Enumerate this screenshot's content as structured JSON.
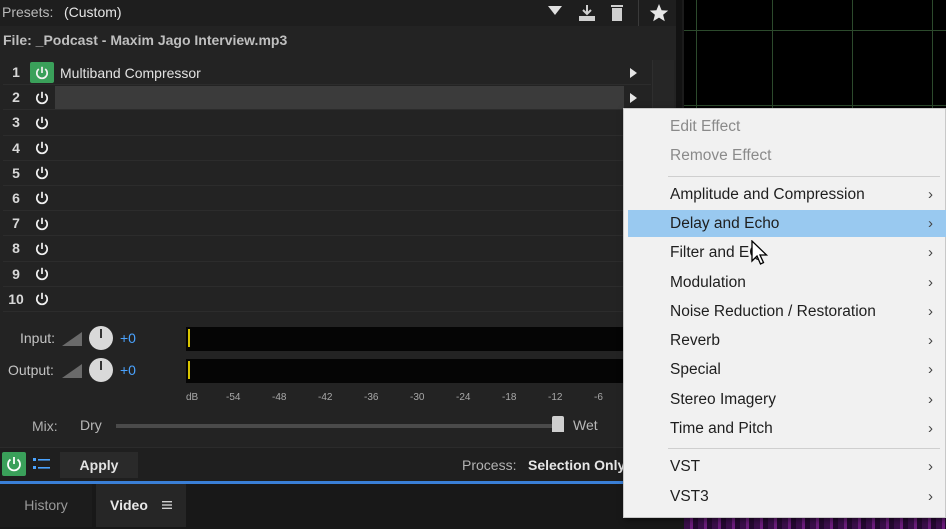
{
  "presets": {
    "label": "Presets:",
    "value": "(Custom)"
  },
  "file": {
    "text": "File: _Podcast - Maxim Jago Interview.mp3"
  },
  "toolbar": {
    "save_icon": "save-icon",
    "delete_icon": "trash-icon",
    "favorite_icon": "star-icon"
  },
  "slots": [
    {
      "num": "1",
      "name": "Multiband Compressor",
      "on": true
    },
    {
      "num": "2",
      "name": "",
      "on": false,
      "selected": true
    },
    {
      "num": "3",
      "name": ""
    },
    {
      "num": "4",
      "name": ""
    },
    {
      "num": "5",
      "name": ""
    },
    {
      "num": "6",
      "name": ""
    },
    {
      "num": "7",
      "name": ""
    },
    {
      "num": "8",
      "name": ""
    },
    {
      "num": "9",
      "name": ""
    },
    {
      "num": "10",
      "name": ""
    }
  ],
  "io": {
    "input_label": "Input:",
    "input_value": "+0",
    "output_label": "Output:",
    "output_value": "+0"
  },
  "meter_scale": [
    "dB",
    "-54",
    "-48",
    "-42",
    "-36",
    "-30",
    "-24",
    "-18",
    "-12",
    "-6"
  ],
  "mix": {
    "label": "Mix:",
    "dry": "Dry",
    "wet": "Wet",
    "level": 1.0
  },
  "bottom": {
    "apply": "Apply",
    "process_label": "Process:",
    "process_value": "Selection Only"
  },
  "tabs": {
    "history": "History",
    "video": "Video"
  },
  "menu": {
    "group1": [
      "Edit Effect",
      "Remove Effect"
    ],
    "group2": [
      "Amplitude and Compression",
      "Delay and Echo",
      "Filter and EQ",
      "Modulation",
      "Noise Reduction / Restoration",
      "Reverb",
      "Special",
      "Stereo Imagery",
      "Time and Pitch"
    ],
    "group3": [
      "VST",
      "VST3"
    ],
    "highlighted": "Delay and Echo",
    "submenu_glyph": "›"
  },
  "colors": {
    "power_on": "#3aa05a",
    "accent": "#3a7fd6",
    "menu_hover": "#99c9f0",
    "value_blue": "#4aa3ff"
  }
}
